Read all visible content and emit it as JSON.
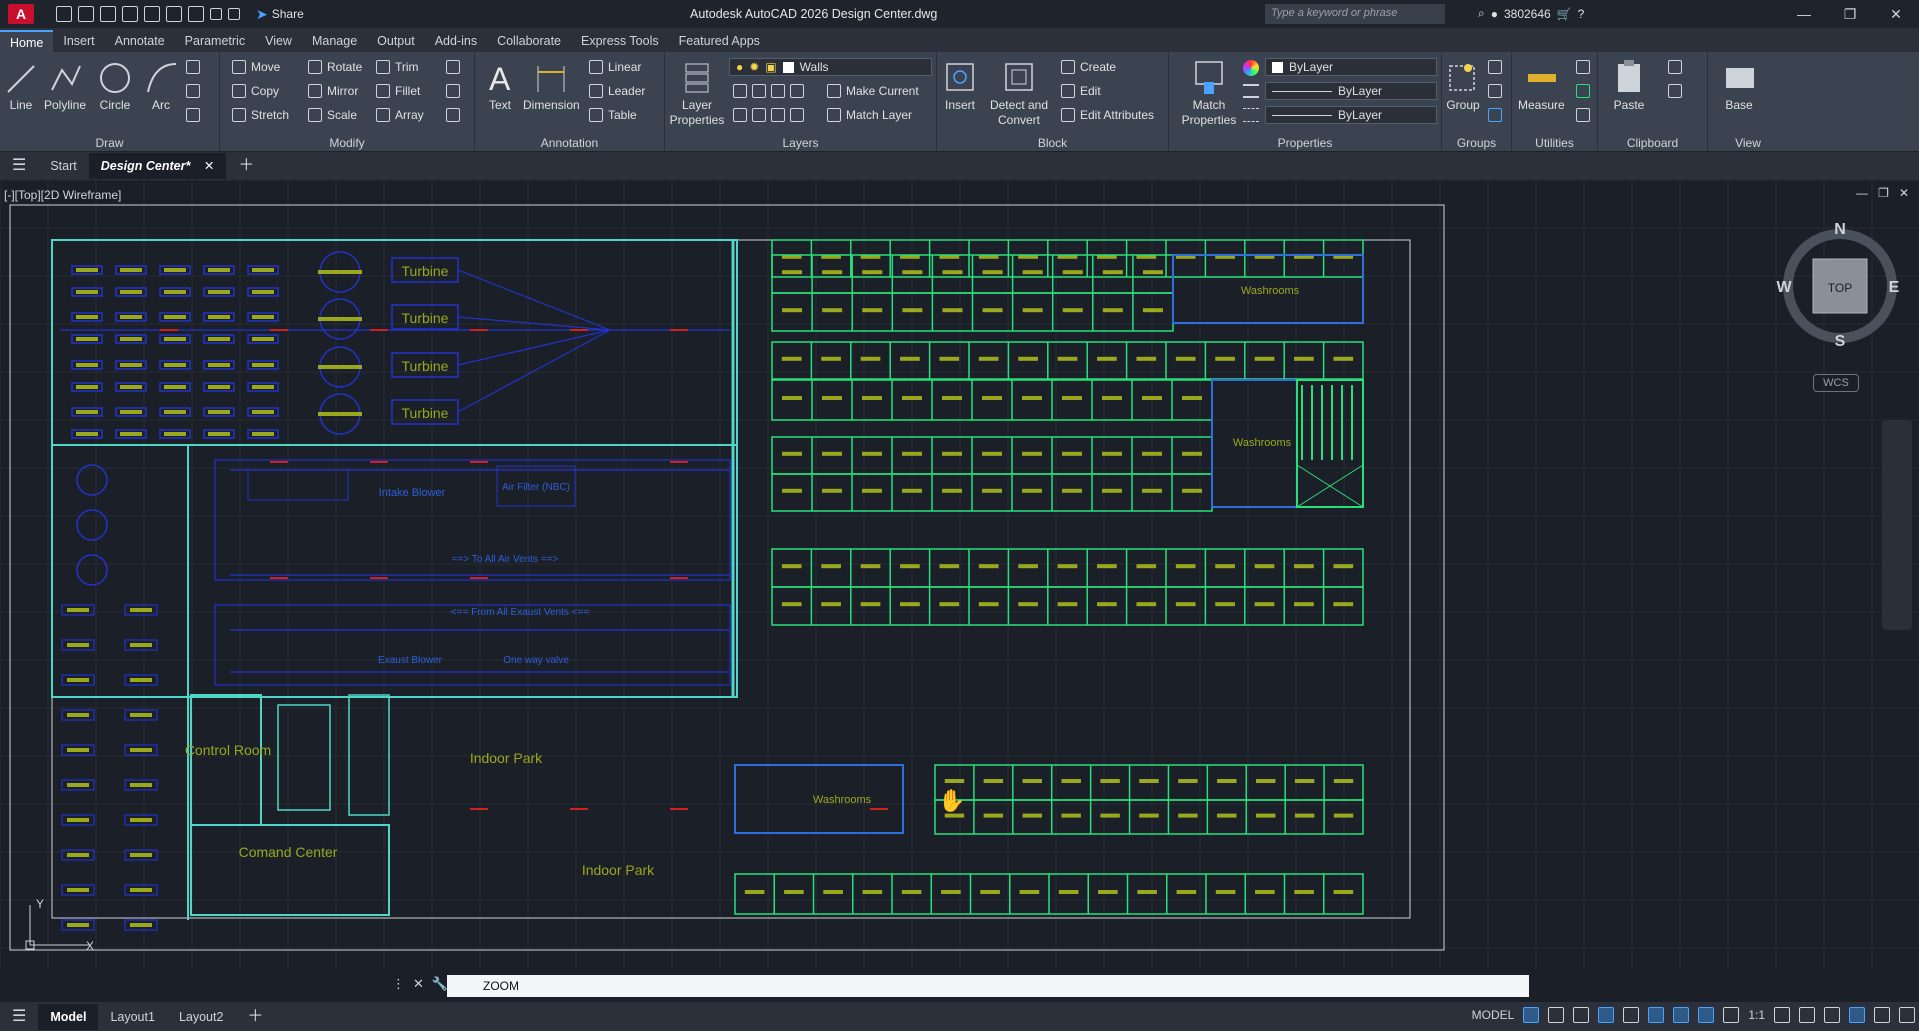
{
  "app": {
    "logo": "A",
    "title": "Autodesk AutoCAD 2026   Design Center.dwg",
    "share_label": "Share",
    "search_placeholder": "Type a keyword or phrase",
    "user_id": "3802646"
  },
  "ribbon_tabs": [
    "Home",
    "Insert",
    "Annotate",
    "Parametric",
    "View",
    "Manage",
    "Output",
    "Add-ins",
    "Collaborate",
    "Express Tools",
    "Featured Apps"
  ],
  "ribbon": {
    "draw": {
      "label": "Draw",
      "tools": [
        "Line",
        "Polyline",
        "Circle",
        "Arc"
      ]
    },
    "modify": {
      "label": "Modify",
      "tools": [
        "Move",
        "Rotate",
        "Trim",
        "Copy",
        "Mirror",
        "Fillet",
        "Stretch",
        "Scale",
        "Array"
      ]
    },
    "annotation": {
      "label": "Annotation",
      "text": "Text",
      "dimension": "Dimension",
      "linear": "Linear",
      "leader": "Leader",
      "table": "Table"
    },
    "layers": {
      "label": "Layers",
      "layer_properties": "Layer Properties",
      "current_layer": "Walls",
      "make_current": "Make Current",
      "match_layer": "Match Layer"
    },
    "block": {
      "label": "Block",
      "insert": "Insert",
      "detect_convert": "Detect and Convert",
      "create": "Create",
      "edit": "Edit",
      "edit_attributes": "Edit Attributes"
    },
    "properties": {
      "label": "Properties",
      "match": "Match Properties",
      "color": "ByLayer",
      "linetype": "ByLayer",
      "lineweight": "ByLayer"
    },
    "groups": {
      "label": "Groups",
      "group": "Group"
    },
    "utilities": {
      "label": "Utilities",
      "measure": "Measure"
    },
    "clipboard": {
      "label": "Clipboard",
      "paste": "Paste"
    },
    "view": {
      "label": "View",
      "base": "Base"
    }
  },
  "doc_tabs": {
    "start": "Start",
    "active": "Design Center*"
  },
  "viewport_label": "[-][Top][2D Wireframe]",
  "viewcube": {
    "n": "N",
    "s": "S",
    "e": "E",
    "w": "W",
    "top": "TOP",
    "wcs": "WCS"
  },
  "drawing": {
    "turbines": [
      "Turbine",
      "Turbine",
      "Turbine",
      "Turbine"
    ],
    "intake_blower": "Intake Blower",
    "air_filter": "Air Filter (NBC)",
    "to_air_vents": "==> To All Air Vents ==>",
    "from_exhaust": "<== From All Exaust Vents <==",
    "exaust_blower": "Exaust Blower",
    "one_way_valve": "One way valve",
    "control_room": "Control Room",
    "comand_center": "Comand Center",
    "indoor_park_1": "Indoor Park",
    "indoor_park_2": "Indoor Park",
    "washrooms": [
      "Washrooms",
      "Washrooms",
      "Washrooms"
    ]
  },
  "command": {
    "text": "ZOOM"
  },
  "layout_tabs": [
    "Model",
    "Layout1",
    "Layout2"
  ],
  "status": {
    "model": "MODEL",
    "scale": "1:1"
  },
  "colors": {
    "accent": "#4ca3ff",
    "room": "#28e07a",
    "duct": "#2233cc",
    "cyan": "#4fd6c8",
    "door": "#ff7aa8",
    "furniture": "#9aa81e",
    "red": "#d02020",
    "text": "#9aa81e"
  }
}
